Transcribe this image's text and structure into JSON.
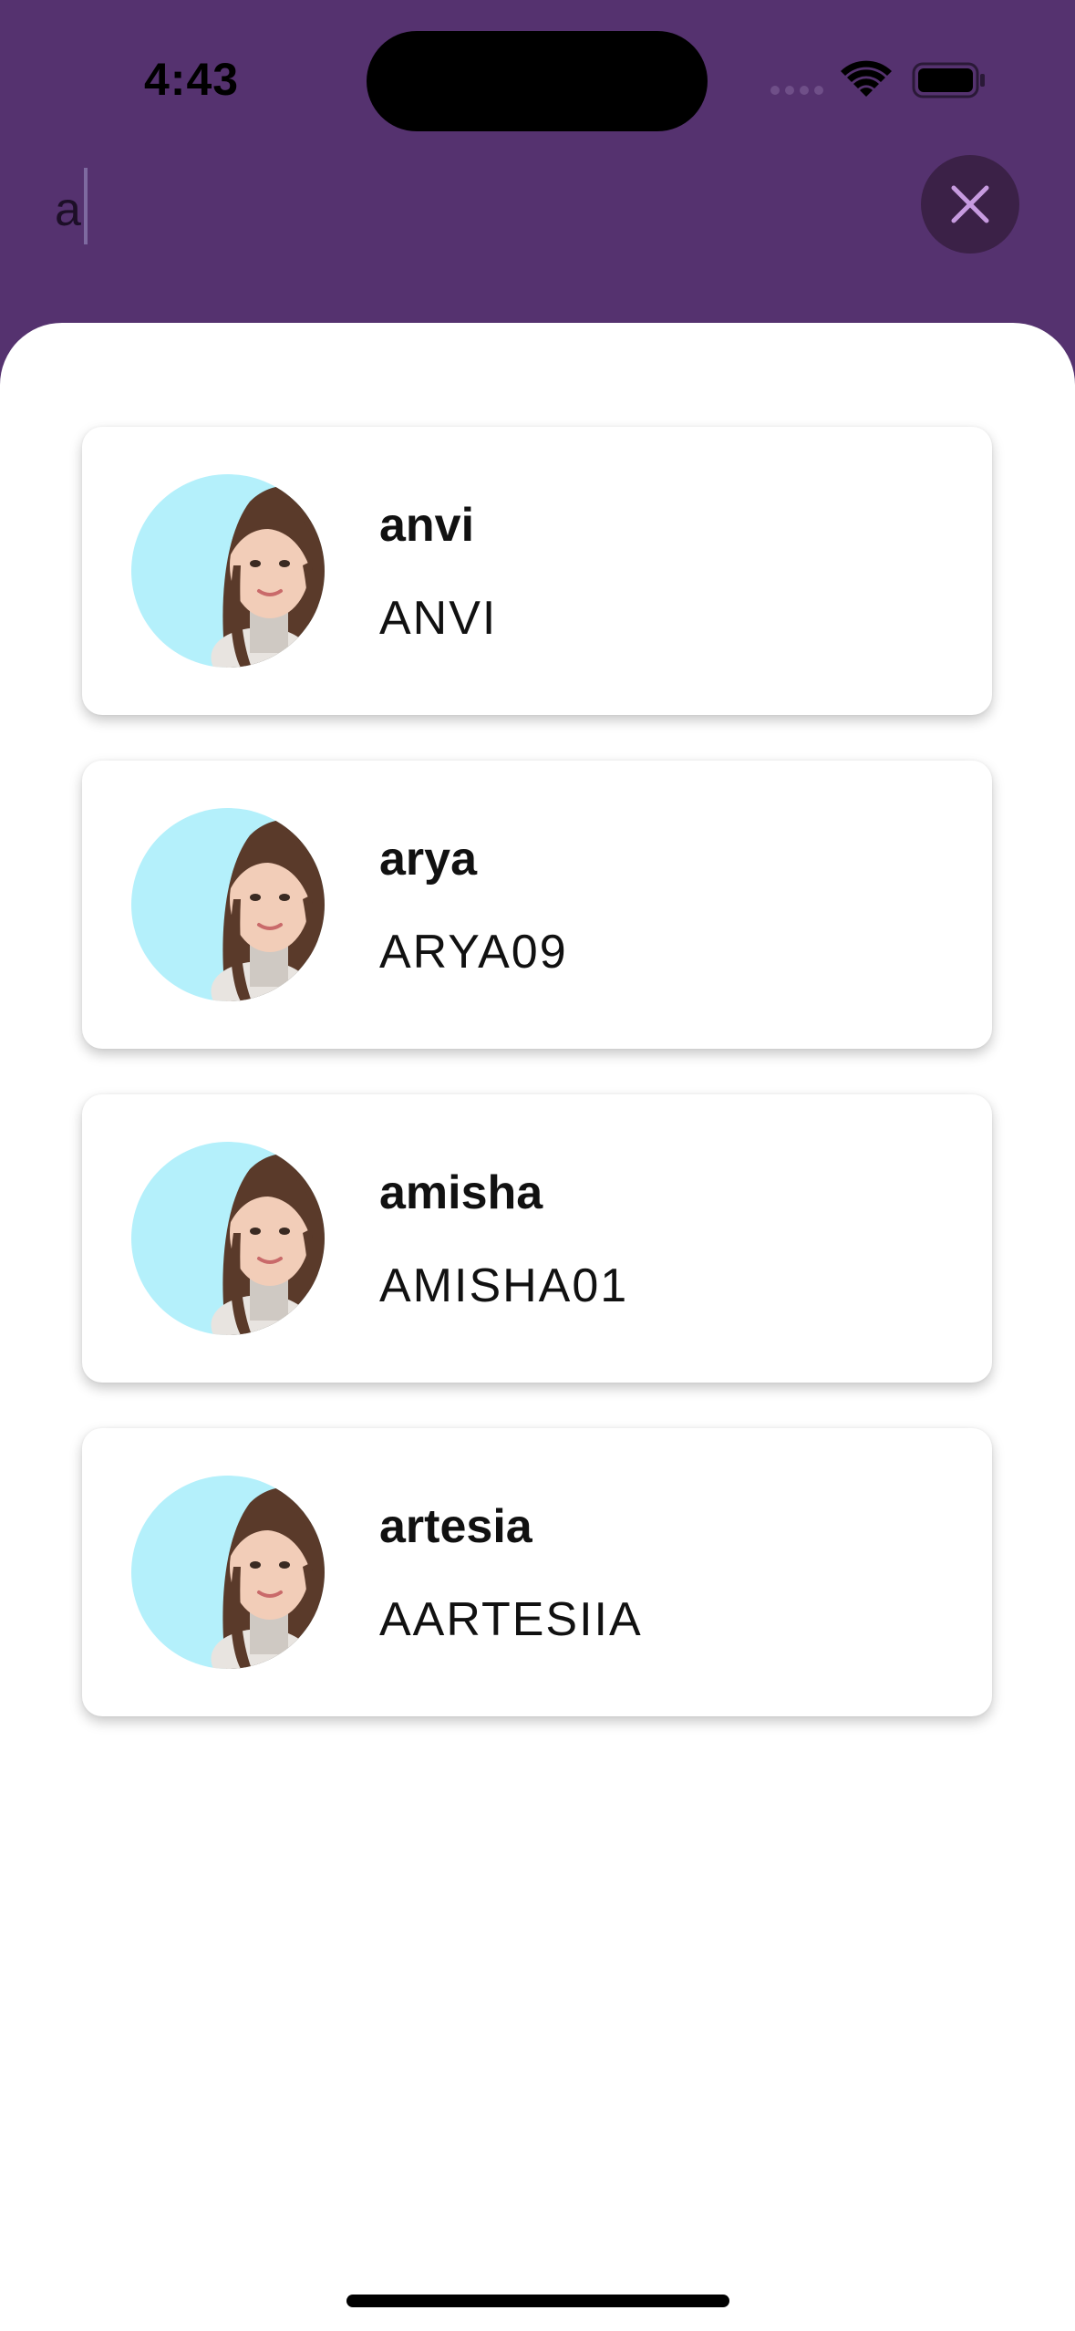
{
  "status_bar": {
    "time": "4:43",
    "icons": [
      "cellular-signal-icon",
      "wifi-icon",
      "battery-icon"
    ]
  },
  "search": {
    "query": "a",
    "close_icon": "close-icon"
  },
  "results": [
    {
      "name": "anvi",
      "handle": "ANVI",
      "avatar": "profile-photo"
    },
    {
      "name": "arya",
      "handle": "ARYA09",
      "avatar": "profile-photo"
    },
    {
      "name": "amisha",
      "handle": "AMISHA01",
      "avatar": "profile-photo"
    },
    {
      "name": "artesia",
      "handle": "AARTESIIA",
      "avatar": "profile-photo"
    }
  ],
  "colors": {
    "header_bg": "#55326f",
    "close_button_bg": "#3b2147",
    "close_icon": "#c79be0",
    "avatar_bg": "#b4f0fb",
    "sheet_bg": "#ffffff"
  }
}
